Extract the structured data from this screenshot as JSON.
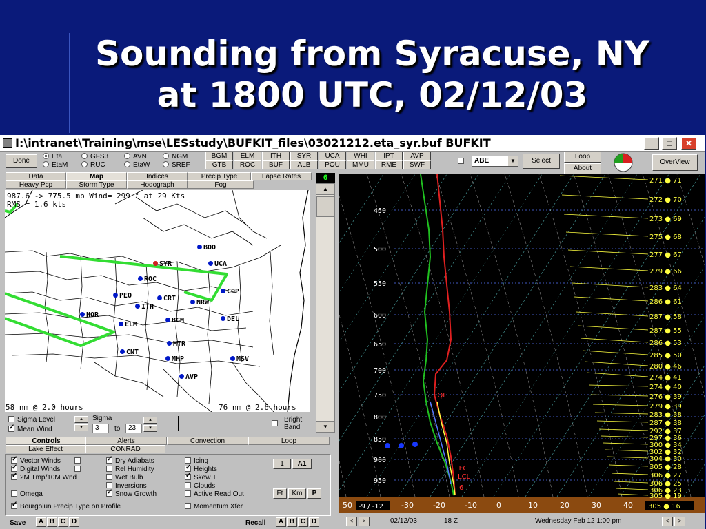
{
  "slide": {
    "title_line1": "Sounding from Syracuse, NY",
    "title_line2": "at 1800 UTC, 02/12/03"
  },
  "window": {
    "title": "I:\\intranet\\Training\\mse\\LESstudy\\BUFKIT_files\\03021212.eta_syr.buf BUFKIT",
    "min": "_",
    "max": "□",
    "close": "✕"
  },
  "toolbar": {
    "done": "Done",
    "models_col1": [
      {
        "label": "Eta",
        "selected": true
      },
      {
        "label": "EtaM",
        "selected": false
      }
    ],
    "models_col2": [
      {
        "label": "GFS3",
        "selected": false
      },
      {
        "label": "RUC",
        "selected": false
      }
    ],
    "models_col3": [
      {
        "label": "AVN",
        "selected": false
      },
      {
        "label": "EtaW",
        "selected": false
      }
    ],
    "models_col4": [
      {
        "label": "NGM",
        "selected": false
      },
      {
        "label": "SREF",
        "selected": false
      }
    ],
    "stations_row1": [
      "BGM",
      "ELM",
      "ITH",
      "SYR",
      "UCA",
      "WHI",
      "IPT",
      "AVP"
    ],
    "stations_row2": [
      "GTB",
      "ROC",
      "BUF",
      "ALB",
      "POU",
      "MMU",
      "RME",
      "SWF"
    ],
    "station_select": "ABE",
    "select": "Select",
    "loop": "Loop",
    "about": "About",
    "overview": "OverView"
  },
  "tabs_row1": [
    {
      "label": "Data",
      "selected": false
    },
    {
      "label": "Map",
      "selected": true
    },
    {
      "label": "Indices",
      "selected": false
    },
    {
      "label": "Precip Type",
      "selected": false
    },
    {
      "label": "Lapse Rates",
      "selected": false
    }
  ],
  "tabs_row2": [
    {
      "label": "Heavy Pcp",
      "selected": false
    },
    {
      "label": "Storm Type",
      "selected": false
    },
    {
      "label": "Hodograph",
      "selected": false
    },
    {
      "label": "Fog",
      "selected": false
    }
  ],
  "tab_badge": "6",
  "map": {
    "wind_line1": "987.6 -> 775.5 mb Wind=  299 ° at 29 Kts",
    "wind_line2": "RMS = 1.6 kts",
    "bottom_left": "58 nm  @ 2.0 hours",
    "bottom_right": "76 nm  @ 2.6 hours",
    "stations": [
      "BOO",
      "UCA",
      "SYR",
      "ROC",
      "COP",
      "PEO",
      "CRT",
      "NRW",
      "ITH",
      "HOR",
      "DEL",
      "ELM",
      "BGM",
      "MTR",
      "CNT",
      "MHP",
      "MSV",
      "AVP"
    ]
  },
  "map_controls": {
    "sigma_level": "Sigma Level",
    "mean_wind": "Mean Wind",
    "sigma_label": "Sigma",
    "sigma_from": "3",
    "to": "to",
    "sigma_to": "23",
    "bright_band": "Bright Band"
  },
  "tabs_lower_row1": [
    "Controls",
    "Alerts",
    "Convection",
    "Loop"
  ],
  "tabs_lower_row2": [
    "Lake Effect",
    "CONRAD"
  ],
  "controls": {
    "col1": [
      {
        "label": "Vector Winds",
        "checked": true
      },
      {
        "label": "Digital Winds",
        "checked": true
      },
      {
        "label": "2M Tmp/10M Wnd",
        "checked": true
      },
      {
        "label": "Omega",
        "checked": false
      },
      {
        "label": "Bourgoiun  Precip Type on Profile",
        "checked": true
      }
    ],
    "col2": [
      {
        "label": "Dry Adiabats",
        "checked": true
      },
      {
        "label": "Rel Humidity",
        "checked": false
      },
      {
        "label": "Wet Bulb",
        "checked": false
      },
      {
        "label": "Inversions",
        "checked": false
      },
      {
        "label": "Snow Growth",
        "checked": true
      }
    ],
    "col3": [
      {
        "label": "Icing",
        "checked": false
      },
      {
        "label": "Heights",
        "checked": true
      },
      {
        "label": "Skew T",
        "checked": true
      },
      {
        "label": "Clouds",
        "checked": false
      },
      {
        "label": "Active Read Out",
        "checked": false
      },
      {
        "label": "Momentum Xfer",
        "checked": false
      }
    ],
    "btn_1": "1",
    "btn_a1": "A1",
    "btn_ft": "Ft",
    "btn_km": "Km",
    "btn_p": "P"
  },
  "footer": {
    "save": "Save",
    "recall": "Recall",
    "slots": [
      "A",
      "B",
      "C",
      "D"
    ]
  },
  "skewt": {
    "pressure_labels": [
      "450",
      "500",
      "550",
      "600",
      "650",
      "700",
      "750",
      "800",
      "850",
      "900",
      "950"
    ],
    "temp_labels": [
      "50",
      "-30",
      "-20",
      "-10",
      "0",
      "10",
      "20",
      "30",
      "40"
    ],
    "readout": "-9 / -12",
    "annotations": [
      "EQL",
      "LFC",
      "LCL",
      "6"
    ],
    "right_labels": [
      {
        "dir": "271",
        "spd": "71"
      },
      {
        "dir": "272",
        "spd": "70"
      },
      {
        "dir": "273",
        "spd": "69"
      },
      {
        "dir": "275",
        "spd": "68"
      },
      {
        "dir": "277",
        "spd": "67"
      },
      {
        "dir": "279",
        "spd": "66"
      },
      {
        "dir": "283",
        "spd": "64"
      },
      {
        "dir": "286",
        "spd": "61"
      },
      {
        "dir": "287",
        "spd": "58"
      },
      {
        "dir": "287",
        "spd": "55"
      },
      {
        "dir": "286",
        "spd": "53"
      },
      {
        "dir": "285",
        "spd": "50"
      },
      {
        "dir": "280",
        "spd": "46"
      },
      {
        "dir": "274",
        "spd": "41"
      },
      {
        "dir": "274",
        "spd": "40"
      },
      {
        "dir": "276",
        "spd": "39"
      },
      {
        "dir": "279",
        "spd": "39"
      },
      {
        "dir": "283",
        "spd": "38"
      },
      {
        "dir": "287",
        "spd": "38"
      },
      {
        "dir": "292",
        "spd": "37"
      },
      {
        "dir": "297",
        "spd": "36"
      },
      {
        "dir": "300",
        "spd": "34"
      },
      {
        "dir": "302",
        "spd": "32"
      },
      {
        "dir": "304",
        "spd": "30"
      },
      {
        "dir": "305",
        "spd": "28"
      },
      {
        "dir": "306",
        "spd": "27"
      },
      {
        "dir": "306",
        "spd": "25"
      },
      {
        "dir": "306",
        "spd": "23"
      },
      {
        "dir": "305",
        "spd": "19"
      }
    ],
    "surface_label": "305 ● 16"
  },
  "status": {
    "date": "02/12/03",
    "hour": "18 Z",
    "valid": "Wednesday  Feb 12  1:00 pm"
  },
  "colors": {
    "slide_bg": "#0a1a7a",
    "temperature": "#e02020",
    "dewpoint": "#20c020",
    "wind_label": "#ffff40",
    "ground": "#8b4a10"
  }
}
